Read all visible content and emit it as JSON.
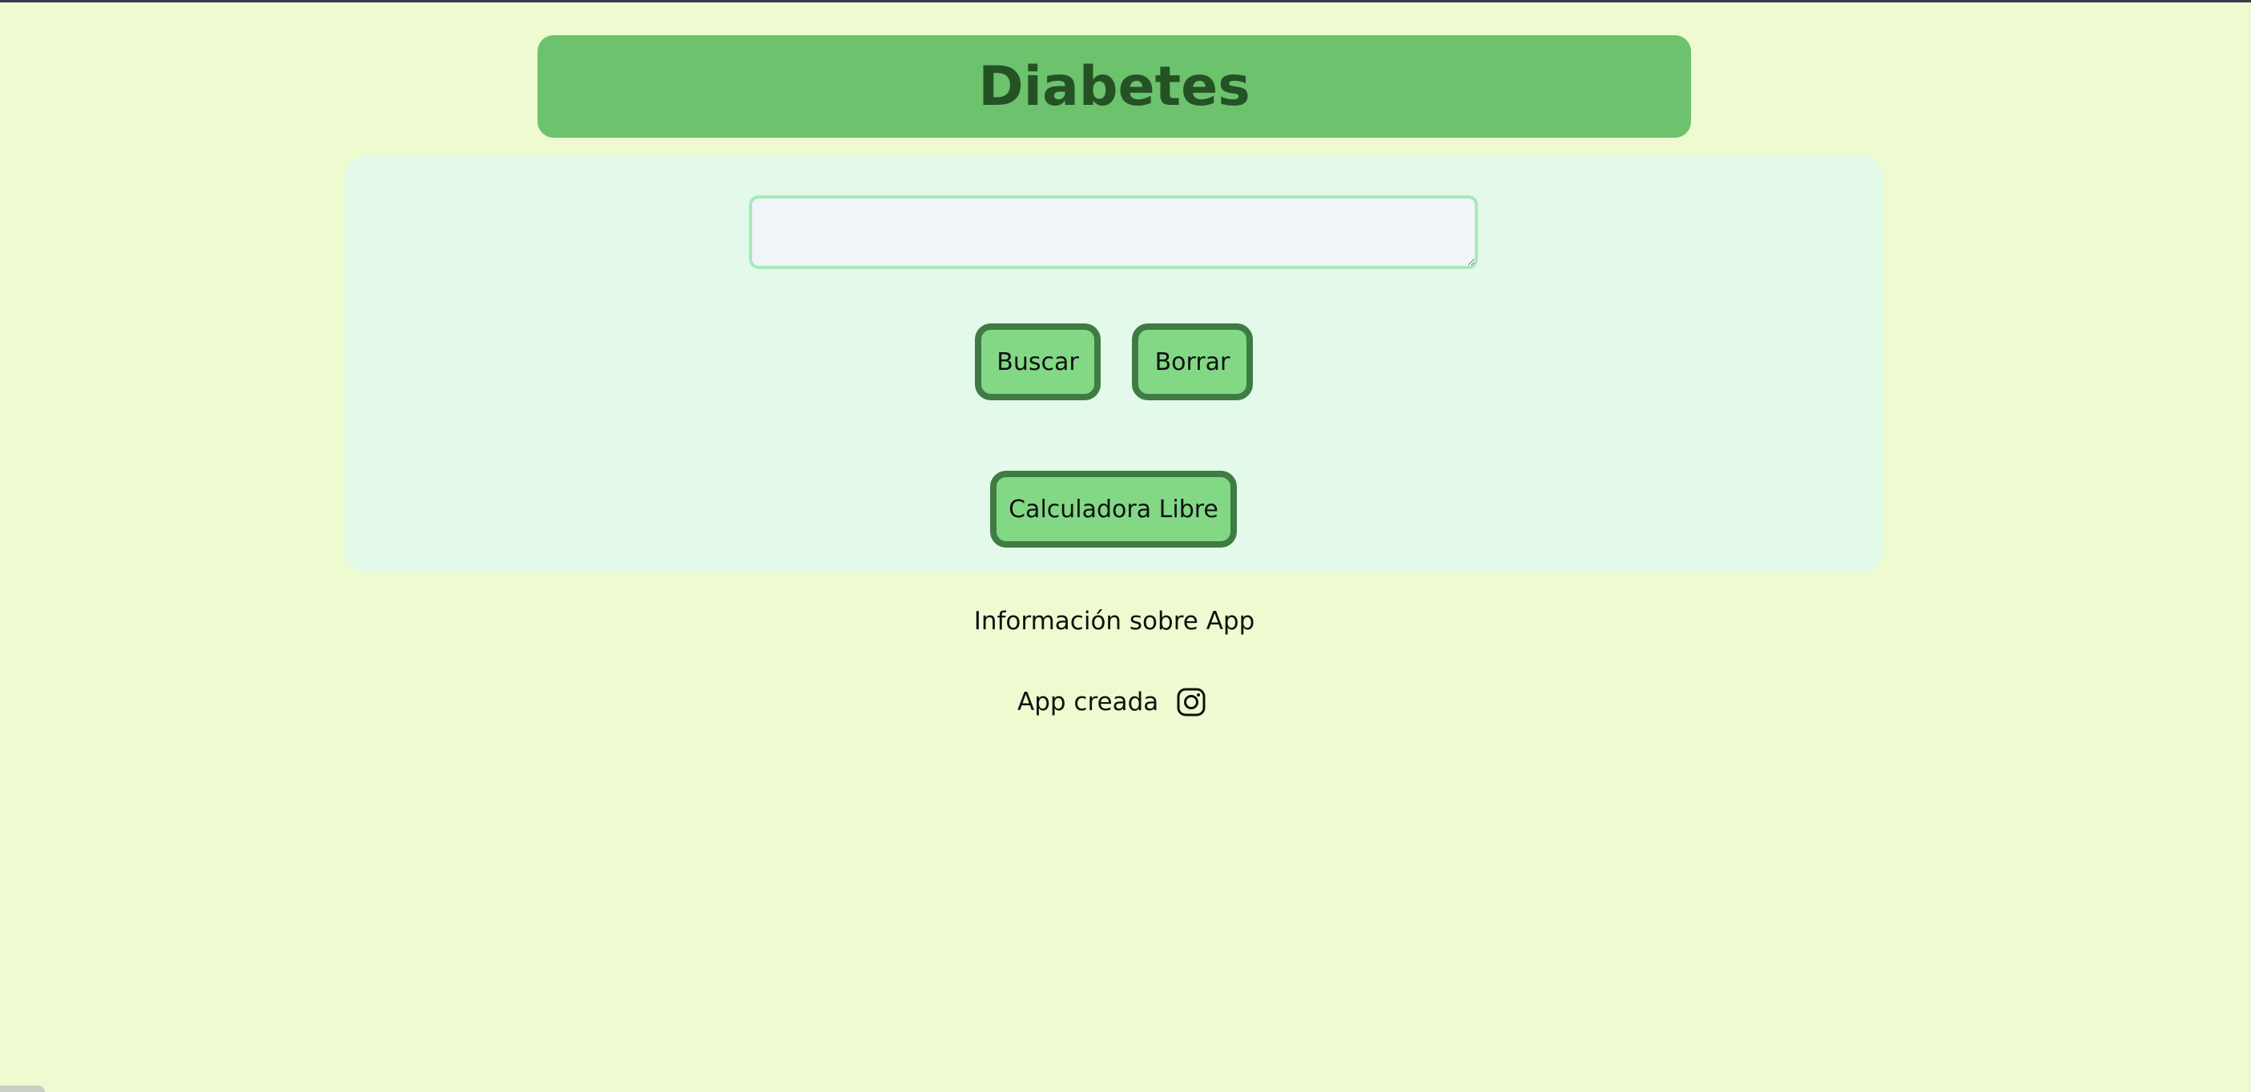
{
  "header": {
    "title": "Diabetes"
  },
  "search": {
    "value": "",
    "placeholder": ""
  },
  "actions": {
    "search_label": "Buscar",
    "clear_label": "Borrar",
    "calculator_label": "Calculadora Libre"
  },
  "links": {
    "info_label": "Información sobre App"
  },
  "footer": {
    "created_label": "App creada",
    "social_icon": "instagram-icon"
  },
  "colors": {
    "page_background": "#eefbd0",
    "header_background": "#6dc36d",
    "title_color": "#245225",
    "panel_background": "#e3f9e9",
    "button_fill": "#83d886",
    "button_border": "#3f7c43",
    "input_border": "#a6eab7"
  }
}
